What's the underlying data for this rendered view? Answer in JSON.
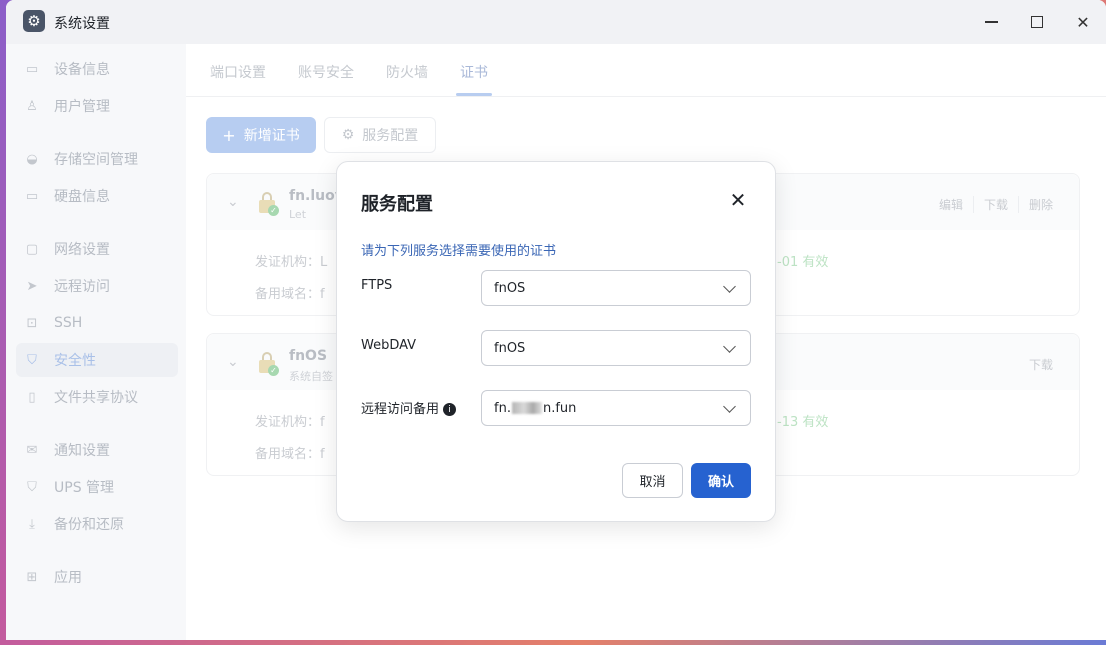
{
  "window": {
    "title": "系统设置",
    "icon": "gear-icon"
  },
  "sidebar": {
    "items": [
      {
        "label": "设备信息",
        "icon": "drive-icon",
        "active": false
      },
      {
        "label": "用户管理",
        "icon": "user-icon",
        "active": false
      },
      {
        "label": "存储空间管理",
        "icon": "storage-icon",
        "active": false
      },
      {
        "label": "硬盘信息",
        "icon": "disk-icon",
        "active": false
      },
      {
        "label": "网络设置",
        "icon": "network-icon",
        "active": false
      },
      {
        "label": "远程访问",
        "icon": "send-icon",
        "active": false
      },
      {
        "label": "SSH",
        "icon": "terminal-icon",
        "active": false
      },
      {
        "label": "安全性",
        "icon": "shield-icon",
        "active": true
      },
      {
        "label": "文件共享协议",
        "icon": "file-icon",
        "active": false
      },
      {
        "label": "通知设置",
        "icon": "mail-icon",
        "active": false
      },
      {
        "label": "UPS 管理",
        "icon": "ups-shield-icon",
        "active": false
      },
      {
        "label": "备份和还原",
        "icon": "backup-icon",
        "active": false
      },
      {
        "label": "应用",
        "icon": "apps-icon",
        "active": false
      }
    ]
  },
  "tabs": [
    {
      "label": "端口设置",
      "active": false
    },
    {
      "label": "账号安全",
      "active": false
    },
    {
      "label": "防火墙",
      "active": false
    },
    {
      "label": "证书",
      "active": true
    }
  ],
  "toolbar": {
    "add_label": "新增证书",
    "service_label": "服务配置"
  },
  "certificates": [
    {
      "name": "fn.luoyı",
      "sub": "Let",
      "issuer_label": "发证机构：",
      "issuer_value": "L",
      "alt_label": "备用域名：",
      "alt_value": "f",
      "valid": "-01 有效",
      "actions": [
        "编辑",
        "下载",
        "删除"
      ]
    },
    {
      "name": "fnOS",
      "sub": "系统自签",
      "issuer_label": "发证机构：",
      "issuer_value": "f",
      "alt_label": "备用域名：",
      "alt_value": "f",
      "valid": "-13 有效",
      "actions": [
        "下载"
      ]
    }
  ],
  "dialog": {
    "title": "服务配置",
    "description": "请为下列服务选择需要使用的证书",
    "fields": [
      {
        "label": "FTPS",
        "value": "fnOS"
      },
      {
        "label": "WebDAV",
        "value": "fnOS"
      },
      {
        "label": "远程访问备用",
        "value_prefix": "fn.",
        "value_suffix": "n.fun"
      }
    ],
    "cancel_label": "取消",
    "confirm_label": "确认"
  },
  "colors": {
    "accent": "#2662d0",
    "active_sidebar_text": "#a9c0e8",
    "description_text": "#3a66b5"
  }
}
